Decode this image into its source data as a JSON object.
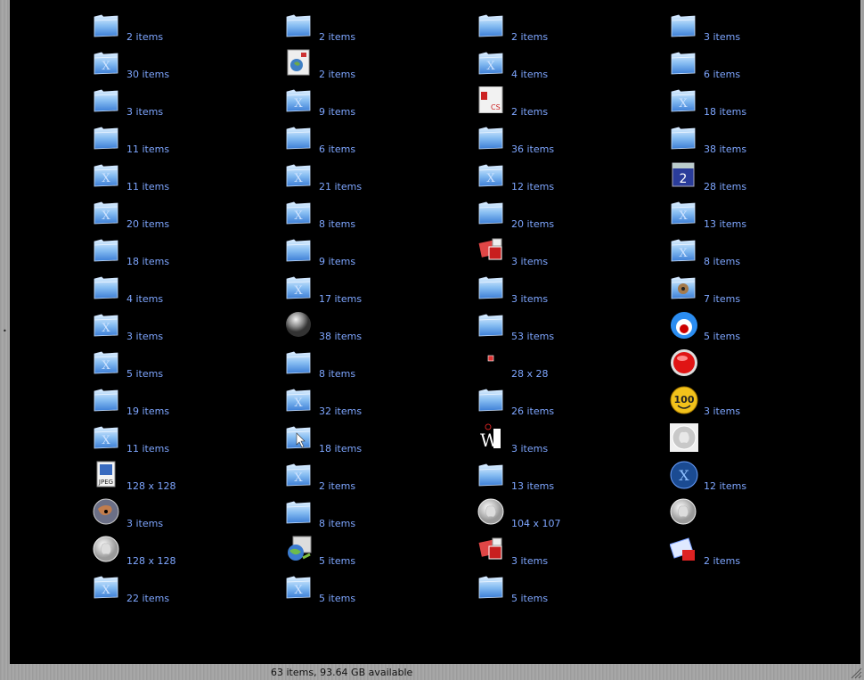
{
  "status": "63 items, 93.64 GB available",
  "columns": [
    {
      "items": [
        {
          "icon": "folder-icon",
          "label": "2 items"
        },
        {
          "icon": "folder-x-icon",
          "label": "30 items"
        },
        {
          "icon": "folder-icon",
          "label": "3 items"
        },
        {
          "icon": "folder-icon",
          "label": "11 items"
        },
        {
          "icon": "folder-x-icon",
          "label": "11 items"
        },
        {
          "icon": "folder-x-icon",
          "label": "20 items"
        },
        {
          "icon": "folder-icon",
          "label": "18 items"
        },
        {
          "icon": "folder-icon",
          "label": "4 items"
        },
        {
          "icon": "folder-x-icon",
          "label": "3 items"
        },
        {
          "icon": "folder-x-icon",
          "label": "5 items"
        },
        {
          "icon": "folder-icon",
          "label": "19 items"
        },
        {
          "icon": "folder-x-icon",
          "label": "11 items"
        },
        {
          "icon": "jpeg-file-icon",
          "label": "128 x 128"
        },
        {
          "icon": "earth-disc-icon",
          "label": "3 items"
        },
        {
          "icon": "apple-disc-icon",
          "label": "128 x 128"
        },
        {
          "icon": "folder-x-icon",
          "label": "22 items"
        }
      ]
    },
    {
      "items": [
        {
          "icon": "folder-icon",
          "label": "2 items"
        },
        {
          "icon": "installer-box-icon",
          "label": "2 items"
        },
        {
          "icon": "folder-x-icon",
          "label": "9 items"
        },
        {
          "icon": "folder-icon",
          "label": "6 items"
        },
        {
          "icon": "folder-x-icon",
          "label": "21 items"
        },
        {
          "icon": "folder-x-icon",
          "label": "8 items"
        },
        {
          "icon": "folder-icon",
          "label": "9 items"
        },
        {
          "icon": "folder-x-icon",
          "label": "17 items"
        },
        {
          "icon": "gray-sphere-icon",
          "label": "38 items"
        },
        {
          "icon": "folder-icon",
          "label": "8 items"
        },
        {
          "icon": "folder-x-icon",
          "label": "32 items"
        },
        {
          "icon": "folder-pointer-icon",
          "label": "18 items"
        },
        {
          "icon": "folder-x-icon",
          "label": "2 items"
        },
        {
          "icon": "folder-icon",
          "label": "8 items"
        },
        {
          "icon": "network-globe-icon",
          "label": "5 items"
        },
        {
          "icon": "folder-x-icon",
          "label": "5 items"
        }
      ]
    },
    {
      "items": [
        {
          "icon": "folder-icon",
          "label": "2 items"
        },
        {
          "icon": "folder-x-icon",
          "label": "4 items"
        },
        {
          "icon": "adobe-cs-box-icon",
          "label": "2 items"
        },
        {
          "icon": "folder-icon",
          "label": "36 items"
        },
        {
          "icon": "folder-x-icon",
          "label": "12 items"
        },
        {
          "icon": "folder-icon",
          "label": "20 items"
        },
        {
          "icon": "red-package-icon",
          "label": "3 items"
        },
        {
          "icon": "folder-icon",
          "label": "3 items"
        },
        {
          "icon": "folder-icon",
          "label": "53 items"
        },
        {
          "icon": "tiny-red-icon",
          "label": "28 x 28"
        },
        {
          "icon": "folder-icon",
          "label": "26 items"
        },
        {
          "icon": "w-logo-icon",
          "label": "3 items"
        },
        {
          "icon": "folder-icon",
          "label": "13 items"
        },
        {
          "icon": "apple-disc-icon",
          "label": "104 x 107"
        },
        {
          "icon": "red-package-icon",
          "label": "3 items"
        },
        {
          "icon": "folder-icon",
          "label": "5 items"
        }
      ]
    },
    {
      "items": [
        {
          "icon": "folder-icon",
          "label": "3 items"
        },
        {
          "icon": "folder-icon",
          "label": "6 items"
        },
        {
          "icon": "folder-x-icon",
          "label": "18 items"
        },
        {
          "icon": "folder-icon",
          "label": "38 items"
        },
        {
          "icon": "calendar-icon",
          "label": "28 items"
        },
        {
          "icon": "folder-x-icon",
          "label": "13 items"
        },
        {
          "icon": "folder-x-icon",
          "label": "8 items"
        },
        {
          "icon": "folder-music-icon",
          "label": "7 items"
        },
        {
          "icon": "blue-ring-icon",
          "label": "5 items"
        },
        {
          "icon": "red-button-icon",
          "label": ""
        },
        {
          "icon": "smiley-100-icon",
          "label": "3 items"
        },
        {
          "icon": "apple-disc-square-icon",
          "label": ""
        },
        {
          "icon": "blue-x-disc-icon",
          "label": "12 items"
        },
        {
          "icon": "apple-disc-icon",
          "label": ""
        },
        {
          "icon": "mail-package-icon",
          "label": "2 items"
        }
      ]
    }
  ],
  "calendar_icon_text": "2"
}
